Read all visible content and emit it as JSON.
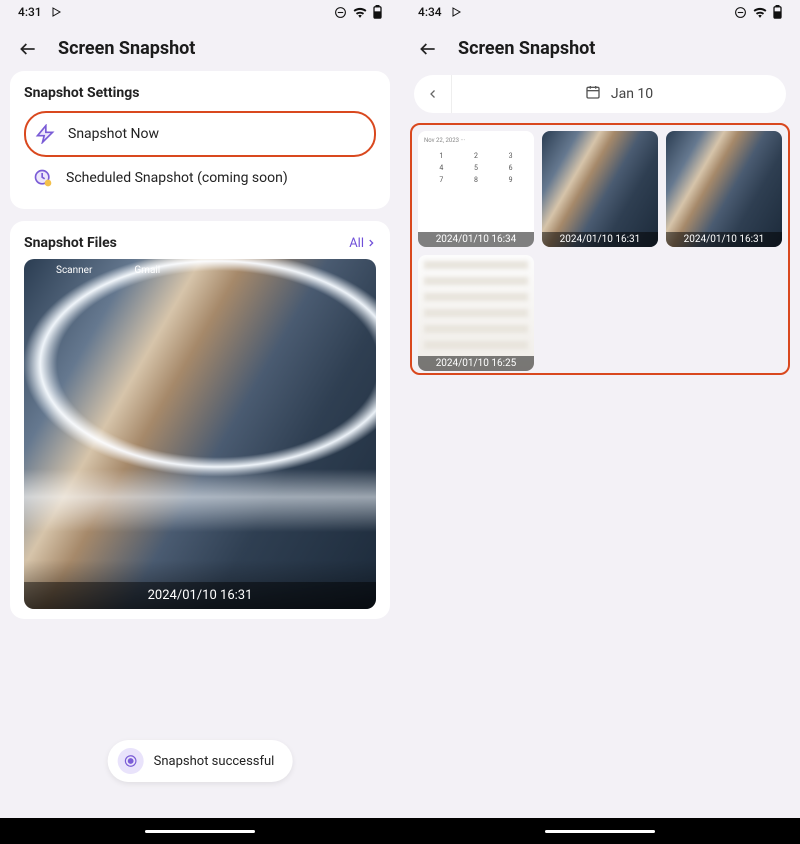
{
  "left": {
    "status": {
      "time": "4:31"
    },
    "title": "Screen Snapshot",
    "settings": {
      "heading": "Snapshot Settings",
      "now": "Snapshot Now",
      "scheduled": "Scheduled Snapshot (coming soon)"
    },
    "files": {
      "heading": "Snapshot Files",
      "all": "All",
      "preview_icons": {
        "scanner": "Scanner",
        "gmail": "Gmail"
      },
      "preview_timestamp": "2024/01/10 16:31"
    },
    "toast": "Snapshot successful"
  },
  "right": {
    "status": {
      "time": "4:34"
    },
    "title": "Screen Snapshot",
    "date": "Jan 10",
    "thumbs": [
      {
        "type": "keypad",
        "ts": "2024/01/10 16:34"
      },
      {
        "type": "mountain",
        "ts": "2024/01/10 16:31"
      },
      {
        "type": "mountain",
        "ts": "2024/01/10 16:31"
      },
      {
        "type": "blur",
        "ts": "2024/01/10 16:25"
      }
    ]
  }
}
